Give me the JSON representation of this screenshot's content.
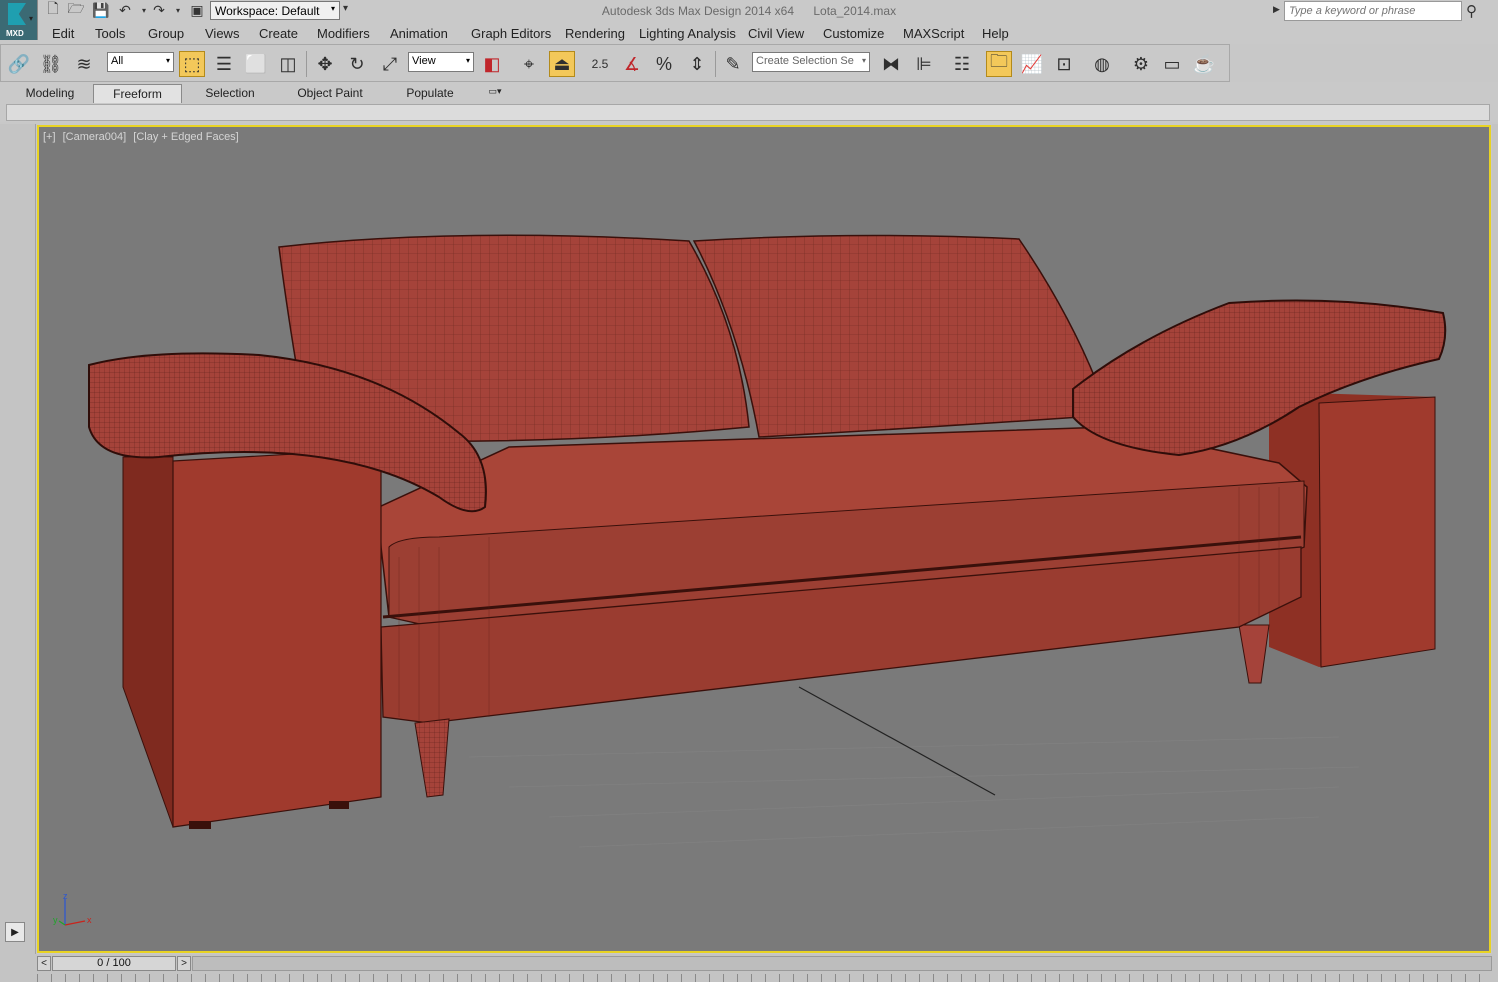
{
  "app": {
    "logo_text": "MXD",
    "title": "Autodesk 3ds Max Design 2014 x64",
    "file": "Lota_2014.max"
  },
  "quick_access": {
    "icons": [
      "new-icon",
      "open-icon",
      "save-icon",
      "undo-icon",
      "redo-icon",
      "project-folder-icon"
    ],
    "workspace_value": "Workspace: Default"
  },
  "search": {
    "placeholder": "Type a keyword or phrase"
  },
  "menu": {
    "items": [
      "Edit",
      "Tools",
      "Group",
      "Views",
      "Create",
      "Modifiers",
      "Animation",
      "Graph Editors",
      "Rendering",
      "Lighting Analysis",
      "Civil View",
      "Customize",
      "MAXScript",
      "Help"
    ]
  },
  "toolbar": {
    "selection_filter": "All",
    "reference_coord": "View",
    "snap_label": "2.5",
    "named_selection_placeholder": "Create Selection Se"
  },
  "ribbon": {
    "tabs": [
      "Modeling",
      "Freeform",
      "Selection",
      "Object Paint",
      "Populate"
    ],
    "selected_tab": "Freeform"
  },
  "viewport": {
    "label_plus": "[+]",
    "label_camera": "[Camera004]",
    "label_shading": "[Clay + Edged Faces]",
    "axis_x": "x",
    "axis_y": "y",
    "axis_z": "z",
    "border_color": "#e8d323",
    "background_color": "#7a7a7a",
    "model_color": "#a5433a"
  },
  "timeslider": {
    "value": "0 / 100",
    "prev": "<",
    "next": ">"
  }
}
